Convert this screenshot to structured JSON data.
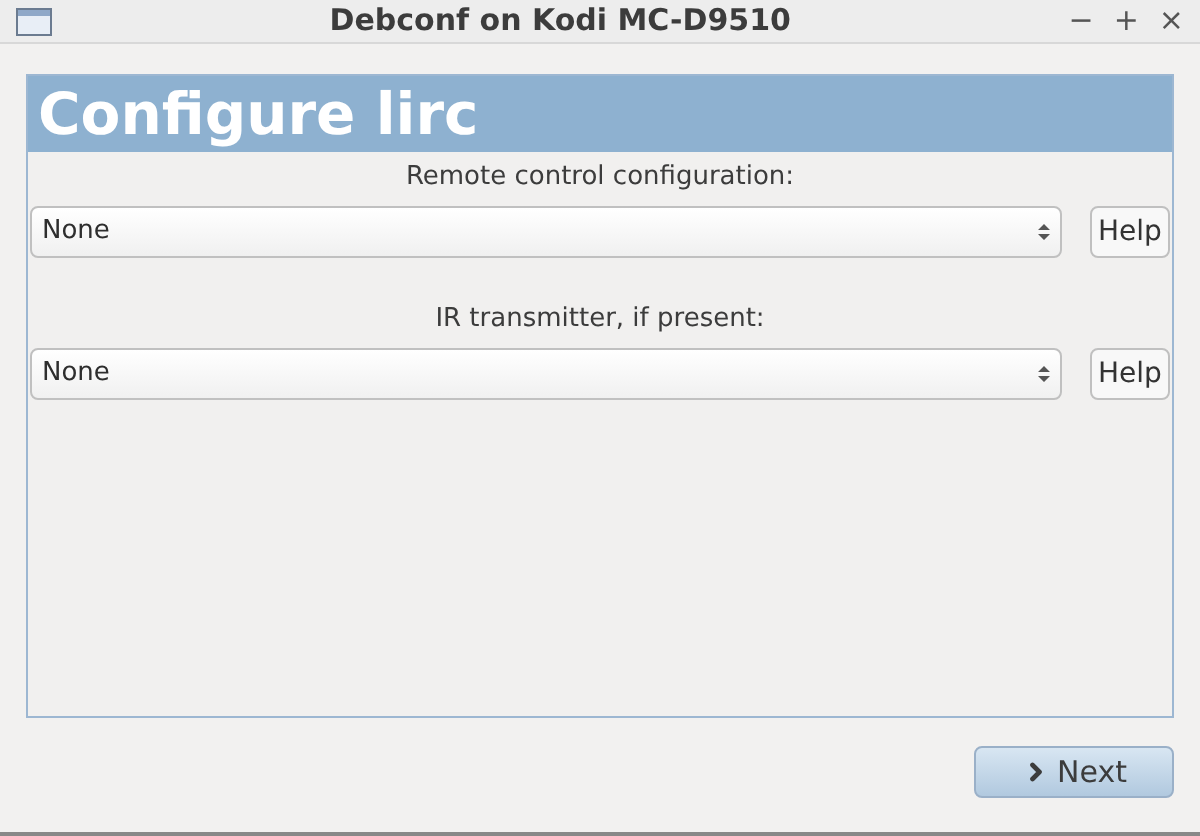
{
  "window": {
    "title": "Debconf on Kodi MC-D9510",
    "controls": [
      "−",
      "+",
      "×"
    ]
  },
  "header": {
    "title": "Configure lirc"
  },
  "questions": [
    {
      "label": "Remote control configuration:",
      "value": "None",
      "help": "Help"
    },
    {
      "label": "IR transmitter, if present:",
      "value": "None",
      "help": "Help"
    }
  ],
  "buttons": [
    {
      "label": "Next"
    }
  ]
}
